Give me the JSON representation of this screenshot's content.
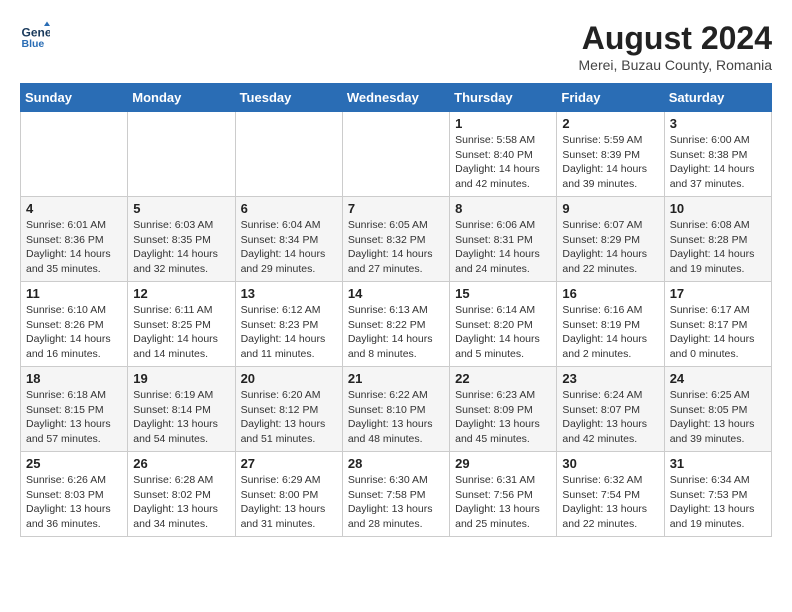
{
  "header": {
    "logo_line1": "General",
    "logo_line2": "Blue",
    "month_year": "August 2024",
    "location": "Merei, Buzau County, Romania"
  },
  "days_of_week": [
    "Sunday",
    "Monday",
    "Tuesday",
    "Wednesday",
    "Thursday",
    "Friday",
    "Saturday"
  ],
  "weeks": [
    [
      {
        "num": "",
        "info": ""
      },
      {
        "num": "",
        "info": ""
      },
      {
        "num": "",
        "info": ""
      },
      {
        "num": "",
        "info": ""
      },
      {
        "num": "1",
        "info": "Sunrise: 5:58 AM\nSunset: 8:40 PM\nDaylight: 14 hours\nand 42 minutes."
      },
      {
        "num": "2",
        "info": "Sunrise: 5:59 AM\nSunset: 8:39 PM\nDaylight: 14 hours\nand 39 minutes."
      },
      {
        "num": "3",
        "info": "Sunrise: 6:00 AM\nSunset: 8:38 PM\nDaylight: 14 hours\nand 37 minutes."
      }
    ],
    [
      {
        "num": "4",
        "info": "Sunrise: 6:01 AM\nSunset: 8:36 PM\nDaylight: 14 hours\nand 35 minutes."
      },
      {
        "num": "5",
        "info": "Sunrise: 6:03 AM\nSunset: 8:35 PM\nDaylight: 14 hours\nand 32 minutes."
      },
      {
        "num": "6",
        "info": "Sunrise: 6:04 AM\nSunset: 8:34 PM\nDaylight: 14 hours\nand 29 minutes."
      },
      {
        "num": "7",
        "info": "Sunrise: 6:05 AM\nSunset: 8:32 PM\nDaylight: 14 hours\nand 27 minutes."
      },
      {
        "num": "8",
        "info": "Sunrise: 6:06 AM\nSunset: 8:31 PM\nDaylight: 14 hours\nand 24 minutes."
      },
      {
        "num": "9",
        "info": "Sunrise: 6:07 AM\nSunset: 8:29 PM\nDaylight: 14 hours\nand 22 minutes."
      },
      {
        "num": "10",
        "info": "Sunrise: 6:08 AM\nSunset: 8:28 PM\nDaylight: 14 hours\nand 19 minutes."
      }
    ],
    [
      {
        "num": "11",
        "info": "Sunrise: 6:10 AM\nSunset: 8:26 PM\nDaylight: 14 hours\nand 16 minutes."
      },
      {
        "num": "12",
        "info": "Sunrise: 6:11 AM\nSunset: 8:25 PM\nDaylight: 14 hours\nand 14 minutes."
      },
      {
        "num": "13",
        "info": "Sunrise: 6:12 AM\nSunset: 8:23 PM\nDaylight: 14 hours\nand 11 minutes."
      },
      {
        "num": "14",
        "info": "Sunrise: 6:13 AM\nSunset: 8:22 PM\nDaylight: 14 hours\nand 8 minutes."
      },
      {
        "num": "15",
        "info": "Sunrise: 6:14 AM\nSunset: 8:20 PM\nDaylight: 14 hours\nand 5 minutes."
      },
      {
        "num": "16",
        "info": "Sunrise: 6:16 AM\nSunset: 8:19 PM\nDaylight: 14 hours\nand 2 minutes."
      },
      {
        "num": "17",
        "info": "Sunrise: 6:17 AM\nSunset: 8:17 PM\nDaylight: 14 hours\nand 0 minutes."
      }
    ],
    [
      {
        "num": "18",
        "info": "Sunrise: 6:18 AM\nSunset: 8:15 PM\nDaylight: 13 hours\nand 57 minutes."
      },
      {
        "num": "19",
        "info": "Sunrise: 6:19 AM\nSunset: 8:14 PM\nDaylight: 13 hours\nand 54 minutes."
      },
      {
        "num": "20",
        "info": "Sunrise: 6:20 AM\nSunset: 8:12 PM\nDaylight: 13 hours\nand 51 minutes."
      },
      {
        "num": "21",
        "info": "Sunrise: 6:22 AM\nSunset: 8:10 PM\nDaylight: 13 hours\nand 48 minutes."
      },
      {
        "num": "22",
        "info": "Sunrise: 6:23 AM\nSunset: 8:09 PM\nDaylight: 13 hours\nand 45 minutes."
      },
      {
        "num": "23",
        "info": "Sunrise: 6:24 AM\nSunset: 8:07 PM\nDaylight: 13 hours\nand 42 minutes."
      },
      {
        "num": "24",
        "info": "Sunrise: 6:25 AM\nSunset: 8:05 PM\nDaylight: 13 hours\nand 39 minutes."
      }
    ],
    [
      {
        "num": "25",
        "info": "Sunrise: 6:26 AM\nSunset: 8:03 PM\nDaylight: 13 hours\nand 36 minutes."
      },
      {
        "num": "26",
        "info": "Sunrise: 6:28 AM\nSunset: 8:02 PM\nDaylight: 13 hours\nand 34 minutes."
      },
      {
        "num": "27",
        "info": "Sunrise: 6:29 AM\nSunset: 8:00 PM\nDaylight: 13 hours\nand 31 minutes."
      },
      {
        "num": "28",
        "info": "Sunrise: 6:30 AM\nSunset: 7:58 PM\nDaylight: 13 hours\nand 28 minutes."
      },
      {
        "num": "29",
        "info": "Sunrise: 6:31 AM\nSunset: 7:56 PM\nDaylight: 13 hours\nand 25 minutes."
      },
      {
        "num": "30",
        "info": "Sunrise: 6:32 AM\nSunset: 7:54 PM\nDaylight: 13 hours\nand 22 minutes."
      },
      {
        "num": "31",
        "info": "Sunrise: 6:34 AM\nSunset: 7:53 PM\nDaylight: 13 hours\nand 19 minutes."
      }
    ]
  ]
}
